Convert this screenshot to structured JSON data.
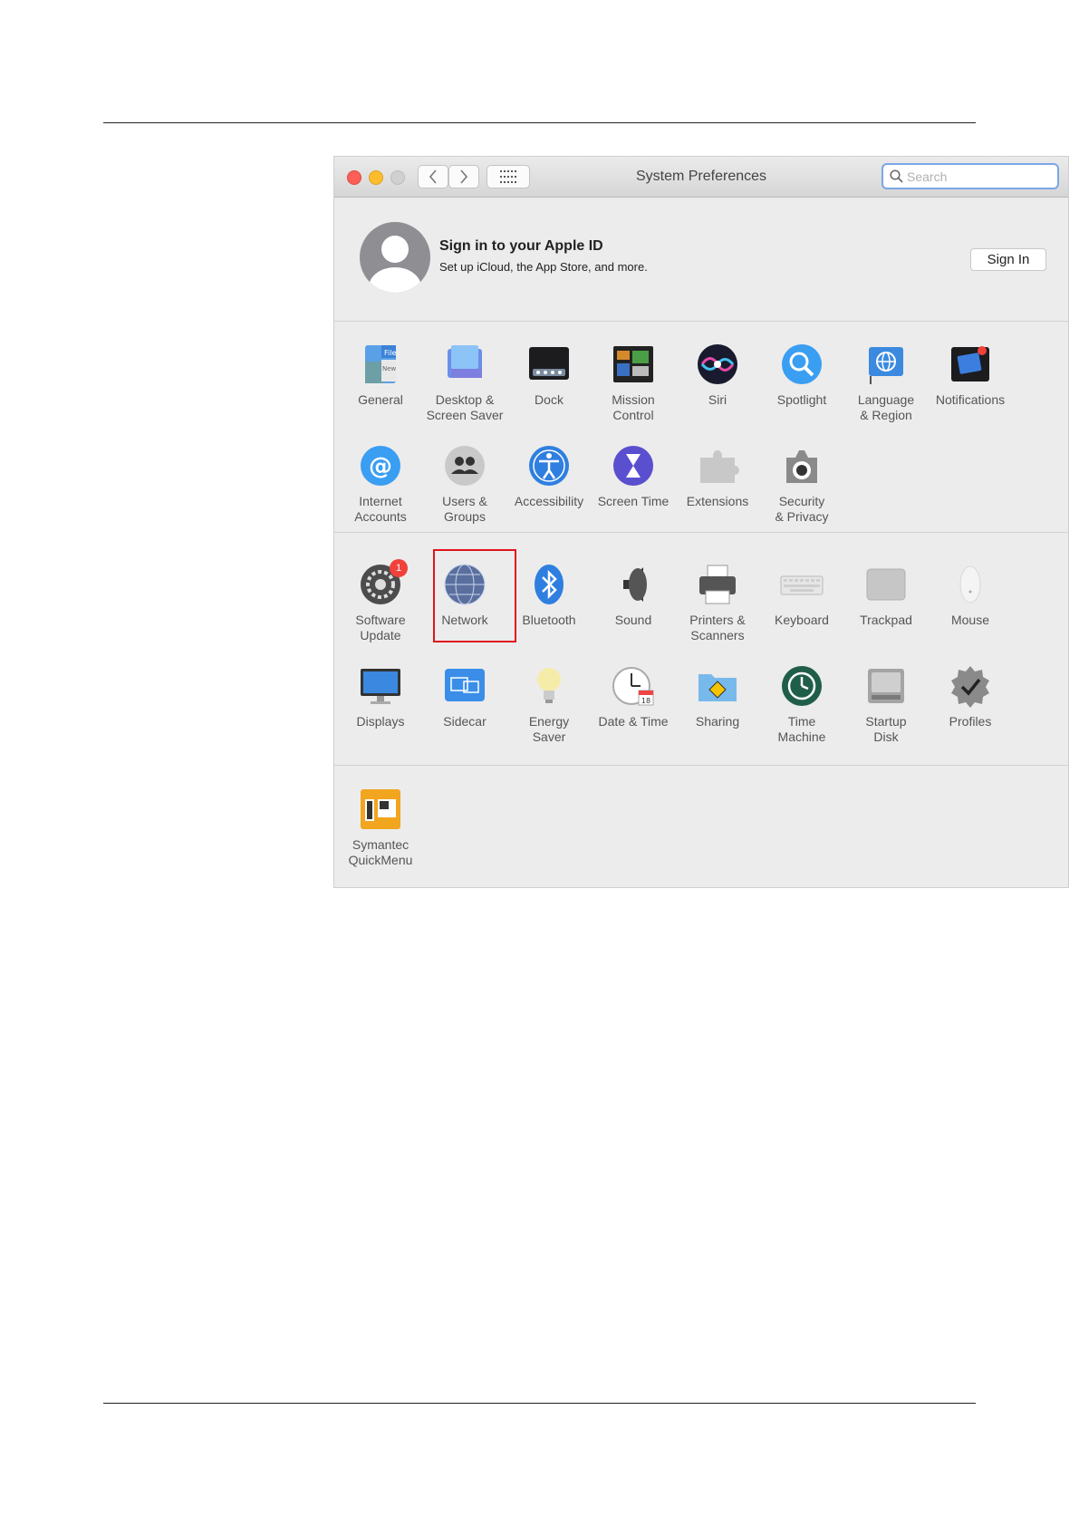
{
  "window": {
    "title": "System Preferences",
    "search_placeholder": "Search"
  },
  "apple_id": {
    "title": "Sign in to your Apple ID",
    "subtitle": "Set up iCloud, the App Store, and more.",
    "sign_in_label": "Sign In"
  },
  "personal": [
    {
      "name": "General",
      "icon": "general-icon"
    },
    {
      "name": "Desktop &\nScreen Saver",
      "icon": "desktop-icon"
    },
    {
      "name": "Dock",
      "icon": "dock-icon"
    },
    {
      "name": "Mission\nControl",
      "icon": "mission-control-icon"
    },
    {
      "name": "Siri",
      "icon": "siri-icon"
    },
    {
      "name": "Spotlight",
      "icon": "spotlight-icon"
    },
    {
      "name": "Language\n& Region",
      "icon": "language-icon"
    },
    {
      "name": "Notifications",
      "icon": "notifications-icon"
    },
    {
      "name": "Internet\nAccounts",
      "icon": "internet-accounts-icon"
    },
    {
      "name": "Users &\nGroups",
      "icon": "users-icon"
    },
    {
      "name": "Accessibility",
      "icon": "accessibility-icon"
    },
    {
      "name": "Screen Time",
      "icon": "screen-time-icon"
    },
    {
      "name": "Extensions",
      "icon": "extensions-icon"
    },
    {
      "name": "Security\n& Privacy",
      "icon": "security-icon"
    }
  ],
  "hardware": [
    {
      "name": "Software\nUpdate",
      "icon": "software-update-icon",
      "badge": "1"
    },
    {
      "name": "Network",
      "icon": "network-icon"
    },
    {
      "name": "Bluetooth",
      "icon": "bluetooth-icon"
    },
    {
      "name": "Sound",
      "icon": "sound-icon"
    },
    {
      "name": "Printers &\nScanners",
      "icon": "printer-icon"
    },
    {
      "name": "Keyboard",
      "icon": "keyboard-icon"
    },
    {
      "name": "Trackpad",
      "icon": "trackpad-icon"
    },
    {
      "name": "Mouse",
      "icon": "mouse-icon"
    },
    {
      "name": "Displays",
      "icon": "displays-icon"
    },
    {
      "name": "Sidecar",
      "icon": "sidecar-icon"
    },
    {
      "name": "Energy\nSaver",
      "icon": "energy-saver-icon"
    },
    {
      "name": "Date & Time",
      "icon": "date-time-icon"
    },
    {
      "name": "Sharing",
      "icon": "sharing-icon"
    },
    {
      "name": "Time\nMachine",
      "icon": "time-machine-icon"
    },
    {
      "name": "Startup\nDisk",
      "icon": "startup-disk-icon"
    },
    {
      "name": "Profiles",
      "icon": "profiles-icon"
    }
  ],
  "other": [
    {
      "name": "Symantec\nQuickMenu",
      "icon": "symantec-icon"
    }
  ],
  "highlighted_pane": "Network"
}
